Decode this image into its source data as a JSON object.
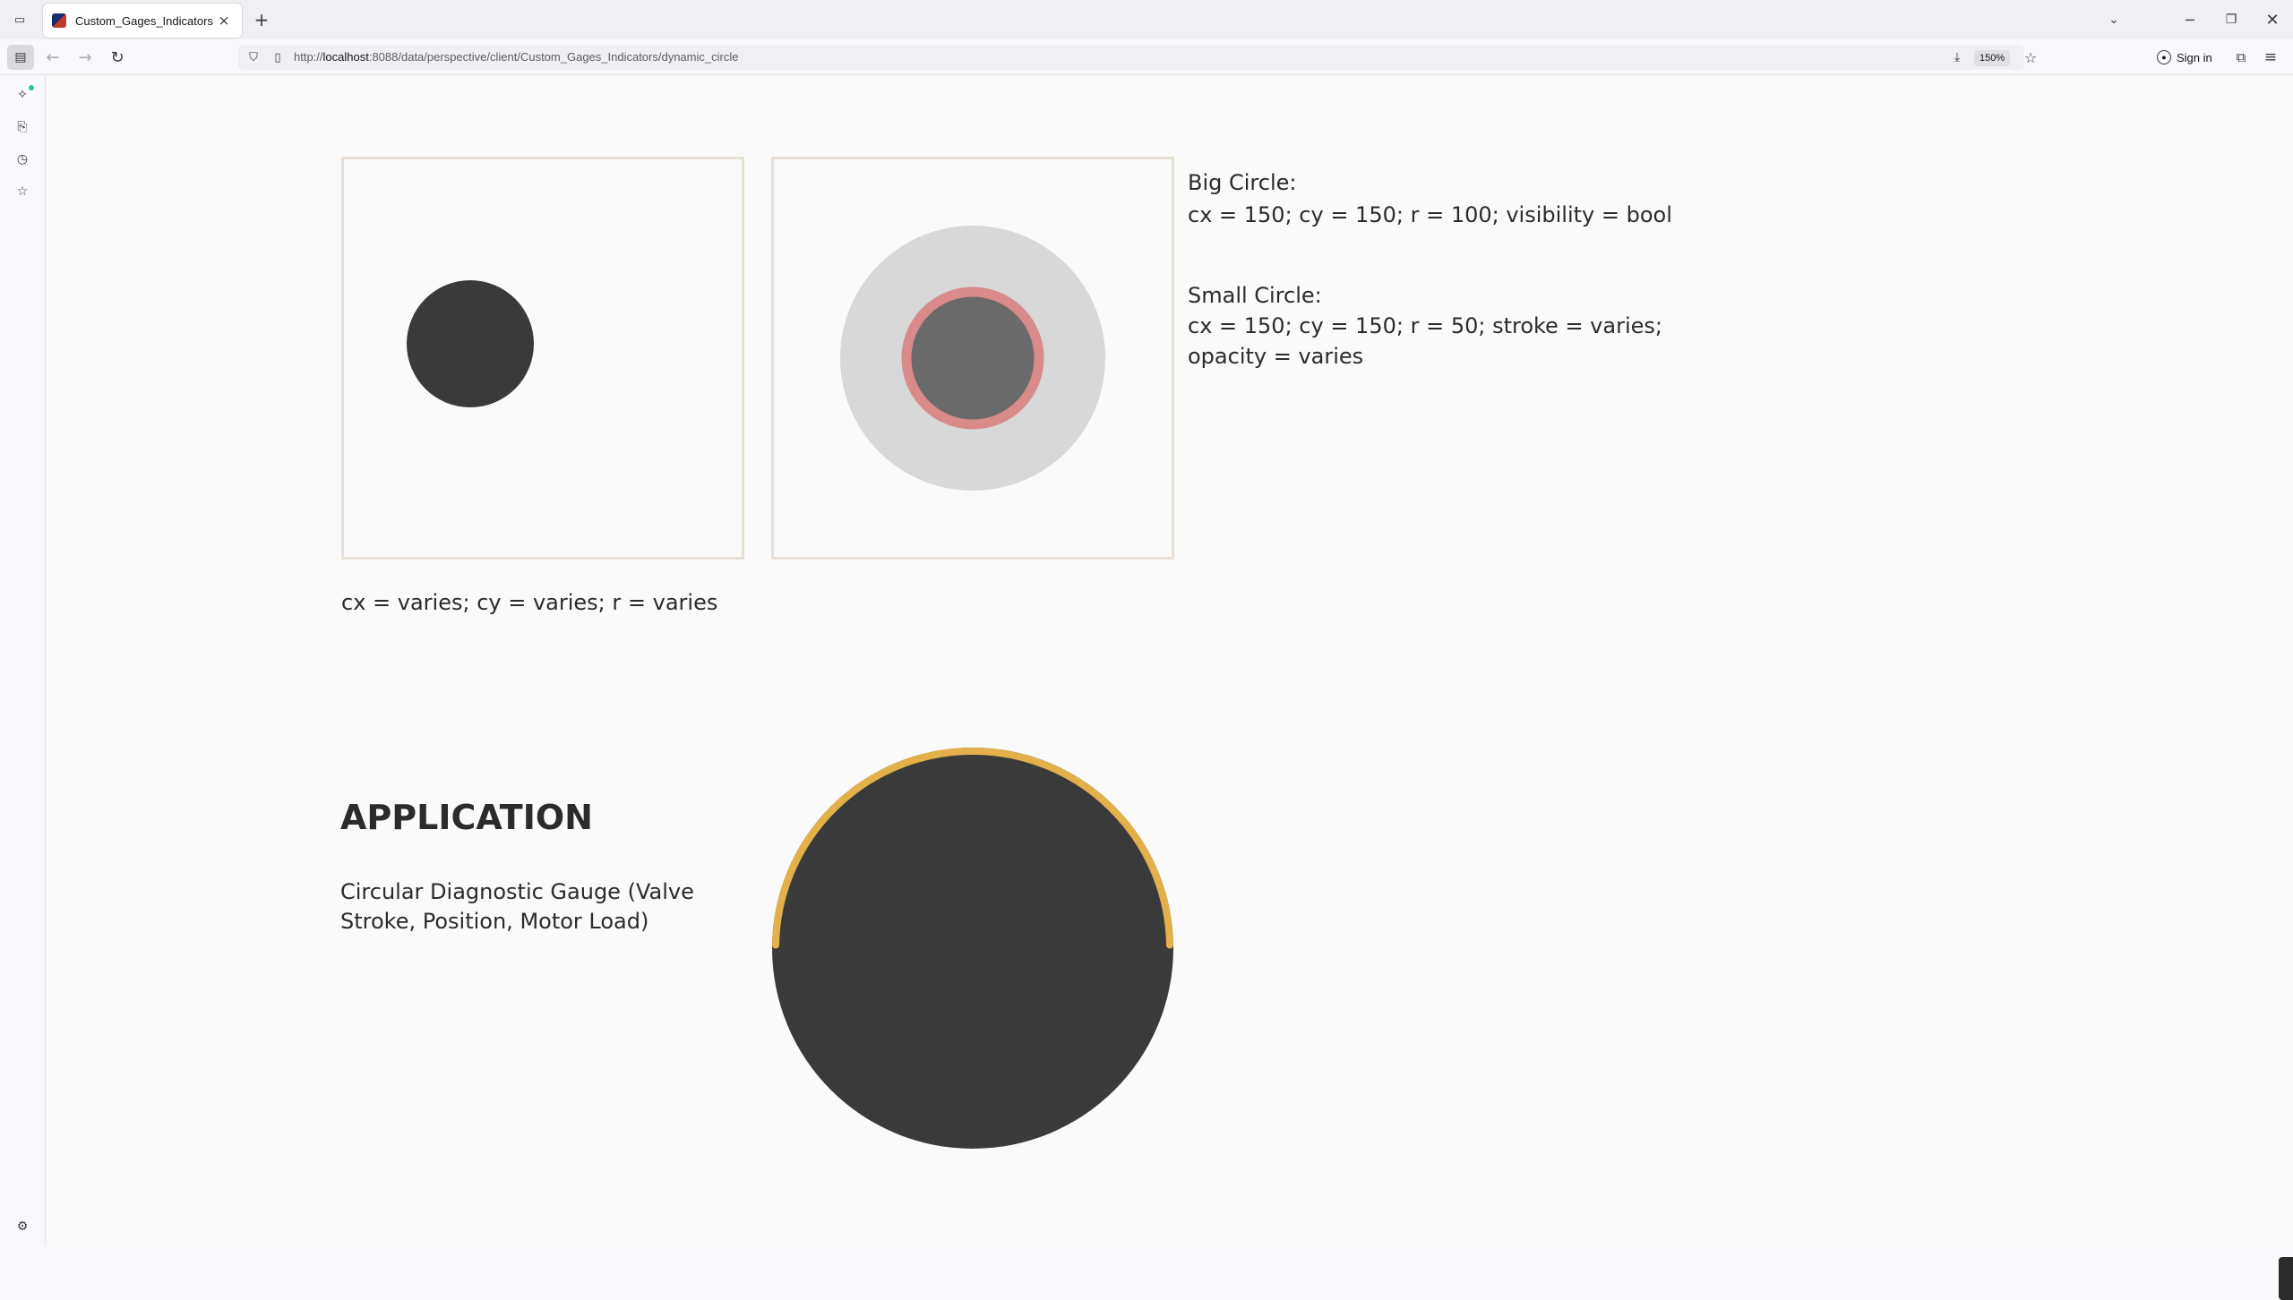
{
  "browser": {
    "tab_title": "Custom_Gages_Indicators",
    "tab_close_icon": "×",
    "new_tab_icon": "+",
    "url_prefix": "http://",
    "url_host": "localhost",
    "url_rest": ":8088/data/perspective/client/Custom_Gages_Indicators/dynamic_circle",
    "zoom": "150%",
    "sign_in_label": "Sign in"
  },
  "content": {
    "big_circle_title": "Big Circle:",
    "big_circle_props": "cx = 150; cy = 150; r = 100; visibility = bool",
    "small_circle_title": "Small Circle:",
    "small_circle_props_line1": "cx = 150; cy = 150; r = 50; stroke = varies;",
    "small_circle_props_line2": "opacity = varies",
    "dynamic_caption": "cx = varies; cy = varies; r = varies",
    "application_heading": "APPLICATION",
    "application_description": "Circular Diagnostic Gauge (Valve Stroke, Position, Motor Load)"
  },
  "colors": {
    "frame_border": "#e8e0d4",
    "dark_circle": "#3a3a3a",
    "big_circle_fill": "#d8d8d8",
    "small_circle_fill": "#6a6a6a",
    "small_circle_stroke": "#d98a8a",
    "gauge_arc": "#e3b049"
  },
  "gauge": {
    "arc_fraction": 0.66
  }
}
